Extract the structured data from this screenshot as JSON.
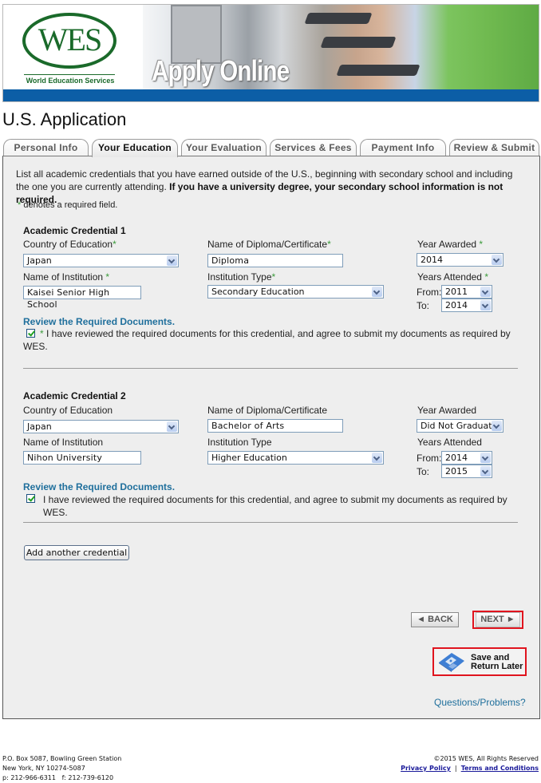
{
  "banner": {
    "logo_text": "WES",
    "logo_subtitle": "World Education Services",
    "headline": "Apply Online",
    "brand_color": "#1a6a2a",
    "bar_color": "#0c5ea6"
  },
  "page_title": "U.S. Application",
  "tabs": [
    {
      "label": "Personal Info",
      "active": false
    },
    {
      "label": "Your Education",
      "active": true
    },
    {
      "label": "Your Evaluation",
      "active": false
    },
    {
      "label": "Services & Fees",
      "active": false
    },
    {
      "label": "Payment Info",
      "active": false
    },
    {
      "label": "Review & Submit",
      "active": false
    }
  ],
  "intro": {
    "text": "List all academic credentials that you have earned outside of the U.S., beginning with secondary school and including the one you are currently attending.",
    "bold_text": "If you have a university degree, your secondary school information is not required.",
    "required_star": "*",
    "required_note": "denotes a required field."
  },
  "labels": {
    "country": "Country of Education",
    "diploma": "Name of Diploma/Certificate",
    "year_awarded": "Year Awarded",
    "institution": "Name of Institution",
    "institution_type": "Institution Type",
    "years_attended": "Years Attended",
    "from": "From:",
    "to": "To:",
    "review_link": "Review the Required Documents.",
    "star": "*"
  },
  "credentials": [
    {
      "title": "Academic Credential 1",
      "country": "Japan",
      "diploma": "Diploma",
      "year_awarded": "2014",
      "institution": "Kaisei Senior High School",
      "institution_type": "Secondary Education",
      "from": "2011",
      "to": "2014",
      "agree_checked": true,
      "agree_text": "I have reviewed the required documents for this credential, and agree to submit my documents as required by WES."
    },
    {
      "title": "Academic Credential 2",
      "country": "Japan",
      "diploma": "Bachelor of Arts",
      "year_awarded": "Did Not Graduate",
      "institution": "Nihon University",
      "institution_type": "Higher Education",
      "from": "2014",
      "to": "2015",
      "agree_checked": true,
      "agree_text": "I have reviewed the required documents for this credential, and agree to submit my documents as required by WES."
    }
  ],
  "buttons": {
    "add_credential": "Add another credential",
    "back": "◄  BACK",
    "next": "NEXT  ►",
    "save_line1": "Save and",
    "save_line2": "Return Later",
    "questions": "Questions/Problems?"
  },
  "footer": {
    "address1": "P.O. Box 5087, Bowling Green Station",
    "address2": "New York, NY 10274-5087",
    "phone": "p: 212-966-6311   f: 212-739-6120",
    "copyright": "©2015 WES, All Rights Reserved",
    "privacy": "Privacy Policy",
    "separator": "|",
    "terms": "Terms and Conditions"
  }
}
